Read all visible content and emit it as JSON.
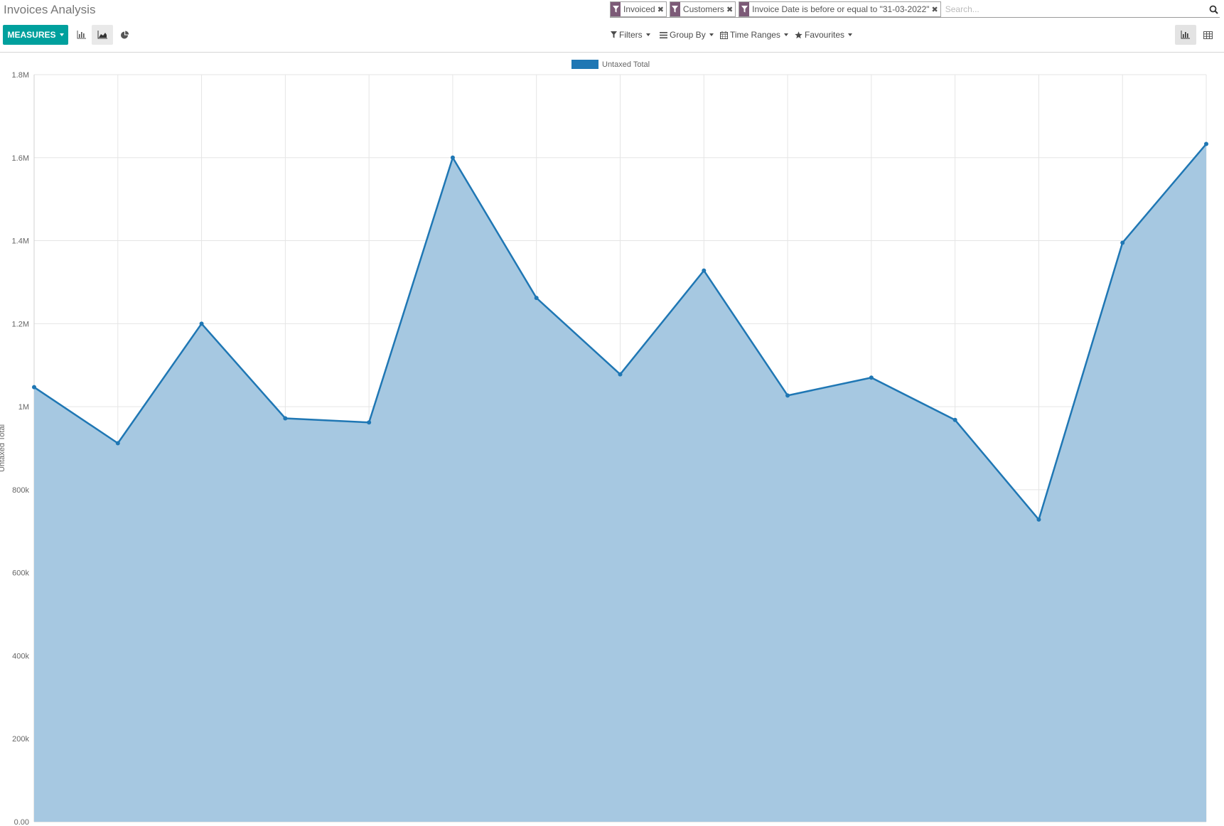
{
  "page": {
    "title": "Invoices Analysis"
  },
  "search": {
    "facets": [
      {
        "label": "Invoiced"
      },
      {
        "label": "Customers"
      },
      {
        "label": "Invoice Date is before or equal to \"31-03-2022\""
      }
    ],
    "placeholder": "Search...",
    "icon": "search-icon"
  },
  "toolbar": {
    "measures_label": "MEASURES",
    "chart_type_icons": [
      "bar-chart-icon",
      "area-chart-icon",
      "pie-chart-icon"
    ],
    "active_chart_type": "area-chart-icon",
    "filters_label": "Filters",
    "groupby_label": "Group By",
    "timeranges_label": "Time Ranges",
    "favourites_label": "Favourites",
    "view_icons": [
      "graph-view-icon",
      "pivot-view-icon"
    ],
    "active_view": "graph-view-icon"
  },
  "colors": {
    "primary": "#00a09d",
    "facet": "#7c5a77",
    "series_line": "#1f77b4",
    "series_fill": "#a6c8e1"
  },
  "chart_data": {
    "type": "area",
    "legend_position": "top-center",
    "grid": true,
    "ylim": [
      0,
      1800000
    ],
    "ytick_values": [
      0,
      200000,
      400000,
      600000,
      800000,
      1000000,
      1200000,
      1400000,
      1600000,
      1800000
    ],
    "ytick_labels": [
      "0.00",
      "200k",
      "400k",
      "600k",
      "800k",
      "1M",
      "1.2M",
      "1.4M",
      "1.6M",
      "1.8M"
    ],
    "ylabel": "Untaxed Total",
    "series": [
      {
        "name": "Untaxed Total",
        "values": [
          1047000,
          912000,
          1200000,
          972000,
          962000,
          1600000,
          1262000,
          1078000,
          1328000,
          1027000,
          1070000,
          968000,
          728000,
          1395000,
          1633000
        ]
      }
    ]
  }
}
